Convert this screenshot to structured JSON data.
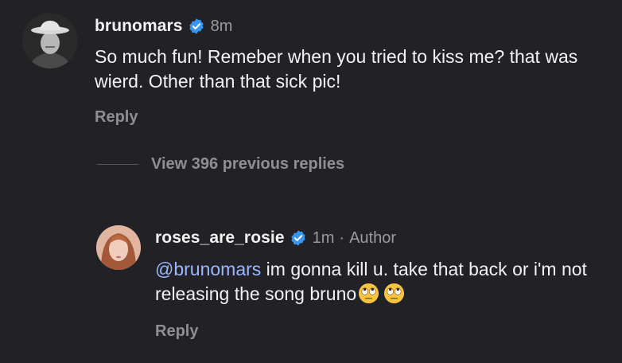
{
  "comments": [
    {
      "username": "brunomars",
      "time": "8m",
      "text": "So much fun! Remeber when you tried to kiss me? that was wierd. Other than that sick pic!",
      "reply_label": "Reply"
    }
  ],
  "view_replies": {
    "label": "View 396 previous replies"
  },
  "reply_comment": {
    "username": "roses_are_rosie",
    "time": "1m",
    "separator": "·",
    "author_badge": "Author",
    "mention": "@brunomars",
    "text": " im gonna kill u. take that back or i'm not releasing the song bruno",
    "emojis": [
      "face-with-rolling-eyes",
      "face-with-rolling-eyes"
    ],
    "reply_label": "Reply"
  },
  "colors": {
    "background": "#222226",
    "verified": "#3797f0",
    "mention": "#9ab8ff",
    "muted": "#8e8e93"
  }
}
